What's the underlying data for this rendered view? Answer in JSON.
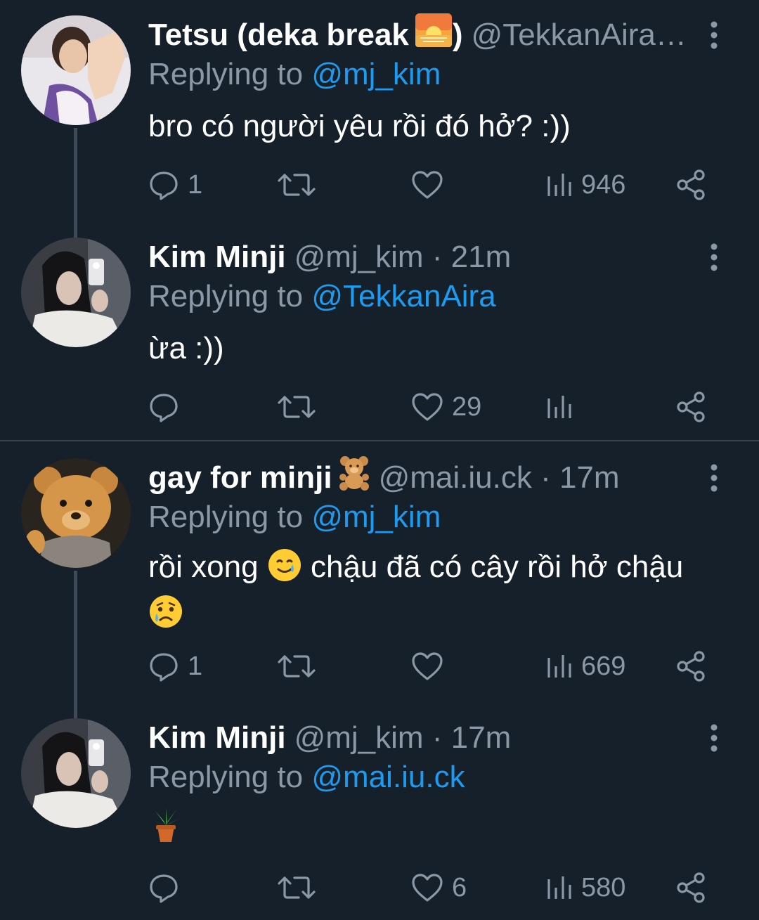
{
  "tweets": [
    {
      "name": "Tetsu (deka break ",
      "name_suffix": ")",
      "name_emoji": "sunrise-icon",
      "handle": "@TekkanAira…",
      "time": "",
      "replying_prefix": "Replying to ",
      "replying_to": "@mj_kim",
      "text": "bro có người yêu rồi đó hở? :))",
      "replies": "1",
      "retweets": "",
      "likes": "",
      "views": "946"
    },
    {
      "name": "Kim Minji",
      "handle": "@mj_kim · 21m",
      "replying_prefix": "Replying to ",
      "replying_to": "@TekkanAira",
      "text": "ừa :))",
      "replies": "",
      "retweets": "",
      "likes": "29",
      "views": ""
    },
    {
      "name": "gay for minji ",
      "name_emoji": "teddy-bear-icon",
      "handle": "@mai.iu.ck · 17m",
      "replying_prefix": "Replying to ",
      "replying_to": "@mj_kim",
      "text_part1": "rồi xong ",
      "text_emoji1": "smiling-face-with-tear-icon",
      "text_part2": " chậu đã có cây rồi hở chậu",
      "text_emoji2": "crying-face-icon",
      "replies": "1",
      "retweets": "",
      "likes": "",
      "views": "669"
    },
    {
      "name": "Kim Minji",
      "handle": "@mj_kim · 17m",
      "replying_prefix": "Replying to ",
      "replying_to": "@mai.iu.ck",
      "text_emoji": "potted-plant-icon",
      "replies": "",
      "retweets": "",
      "likes": "6",
      "views": "580"
    }
  ],
  "colors": {
    "background": "#15202b",
    "muted": "#8b98a5",
    "mention": "#1d9bf0",
    "divider": "#38444d"
  }
}
